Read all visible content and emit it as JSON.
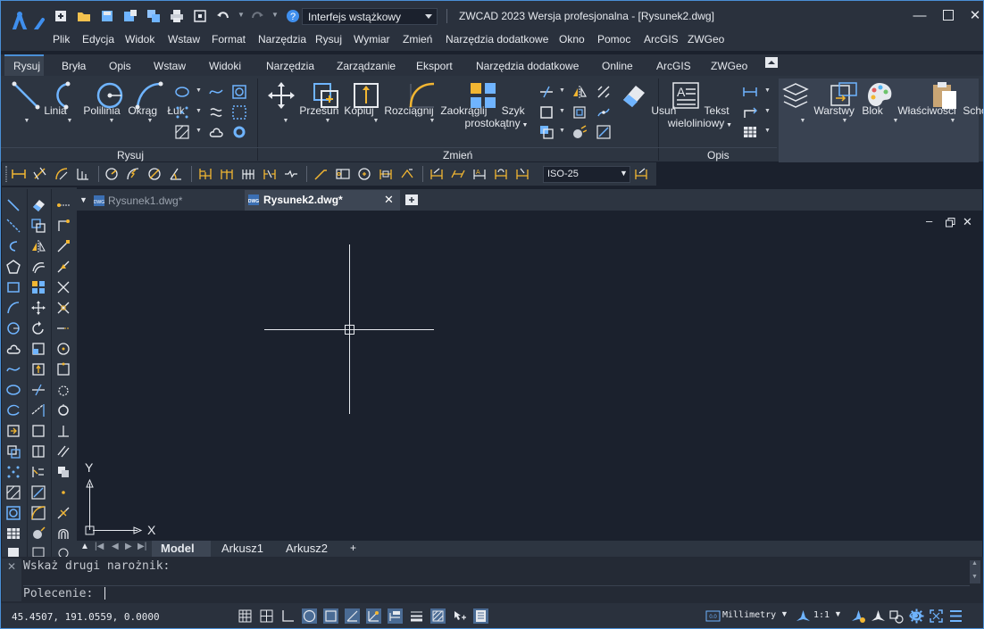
{
  "titlebar": {
    "workspace": "Interfejs wstążkowy",
    "title": "ZWCAD 2023 Wersja profesjonalna - [Rysunek2.dwg]"
  },
  "menu": [
    "Plik",
    "Edycja",
    "Widok",
    "Wstaw",
    "Format",
    "Narzędzia",
    "Rysuj",
    "Wymiar",
    "Zmień",
    "Narzędzia dodatkowe",
    "Okno",
    "Pomoc",
    "ArcGIS",
    "ZWGeo"
  ],
  "ribbon_tabs": [
    "Rysuj",
    "Bryła",
    "Opis",
    "Wstaw",
    "Widoki",
    "Narzędzia",
    "Zarządzanie",
    "Eksport",
    "Narzędzia dodatkowe",
    "Online",
    "ArcGIS",
    "ZWGeo"
  ],
  "draw_panel": {
    "label": "Rysuj",
    "tools": [
      "Linia",
      "Polilinia",
      "Okrąg",
      "Łuk"
    ]
  },
  "modify_panel": {
    "label": "Zmień",
    "tools": [
      "Przesuń",
      "Kopiuj",
      "Rozciągnij",
      "Zaokrąglij"
    ],
    "array_line1": "Szyk",
    "array_line2": "prostokątny",
    "erase": "Usuń"
  },
  "annotation_panel": {
    "label": "Opis",
    "text_line1": "Tekst",
    "text_line2": "wieloliniowy"
  },
  "right_panels": [
    "Warstwy",
    "Blok",
    "Właściwości",
    "Schowek"
  ],
  "dim_style": "ISO-25",
  "doc_tabs": [
    "Rysunek1.dwg*",
    "Rysunek2.dwg*"
  ],
  "canvas": {
    "ucs_x": "X",
    "ucs_y": "Y"
  },
  "layout_tabs": [
    "Model",
    "Arkusz1",
    "Arkusz2",
    "+"
  ],
  "command": {
    "history": "Wskaż drugi narożnik:",
    "prompt": "Polecenie:"
  },
  "status": {
    "coords": "45.4507, 191.0559, 0.0000",
    "units": "Millimetry",
    "scale": "1:1"
  },
  "colors": {
    "accent": "#4a8fd6",
    "background": "#1b212d",
    "panel": "#2d3541",
    "icon_blue": "#6fb4ff",
    "icon_yellow": "#f2b632"
  }
}
